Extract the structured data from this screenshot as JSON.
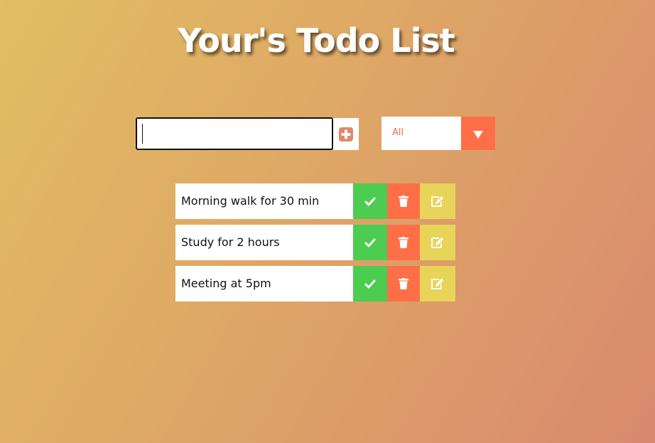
{
  "header": {
    "title": "Your's Todo List"
  },
  "input": {
    "value": "",
    "placeholder": ""
  },
  "add_button": {
    "icon": "plus-square-icon"
  },
  "filter": {
    "selected": "All",
    "icon": "caret-down-icon"
  },
  "todos": [
    {
      "text": "Morning walk for 30 min"
    },
    {
      "text": "Study for 2 hours"
    },
    {
      "text": "Meeting at 5pm"
    }
  ],
  "colors": {
    "complete": "#4ccc51",
    "delete": "#ff6f47",
    "edit": "#e9d45a",
    "accent": "#e1876b"
  }
}
